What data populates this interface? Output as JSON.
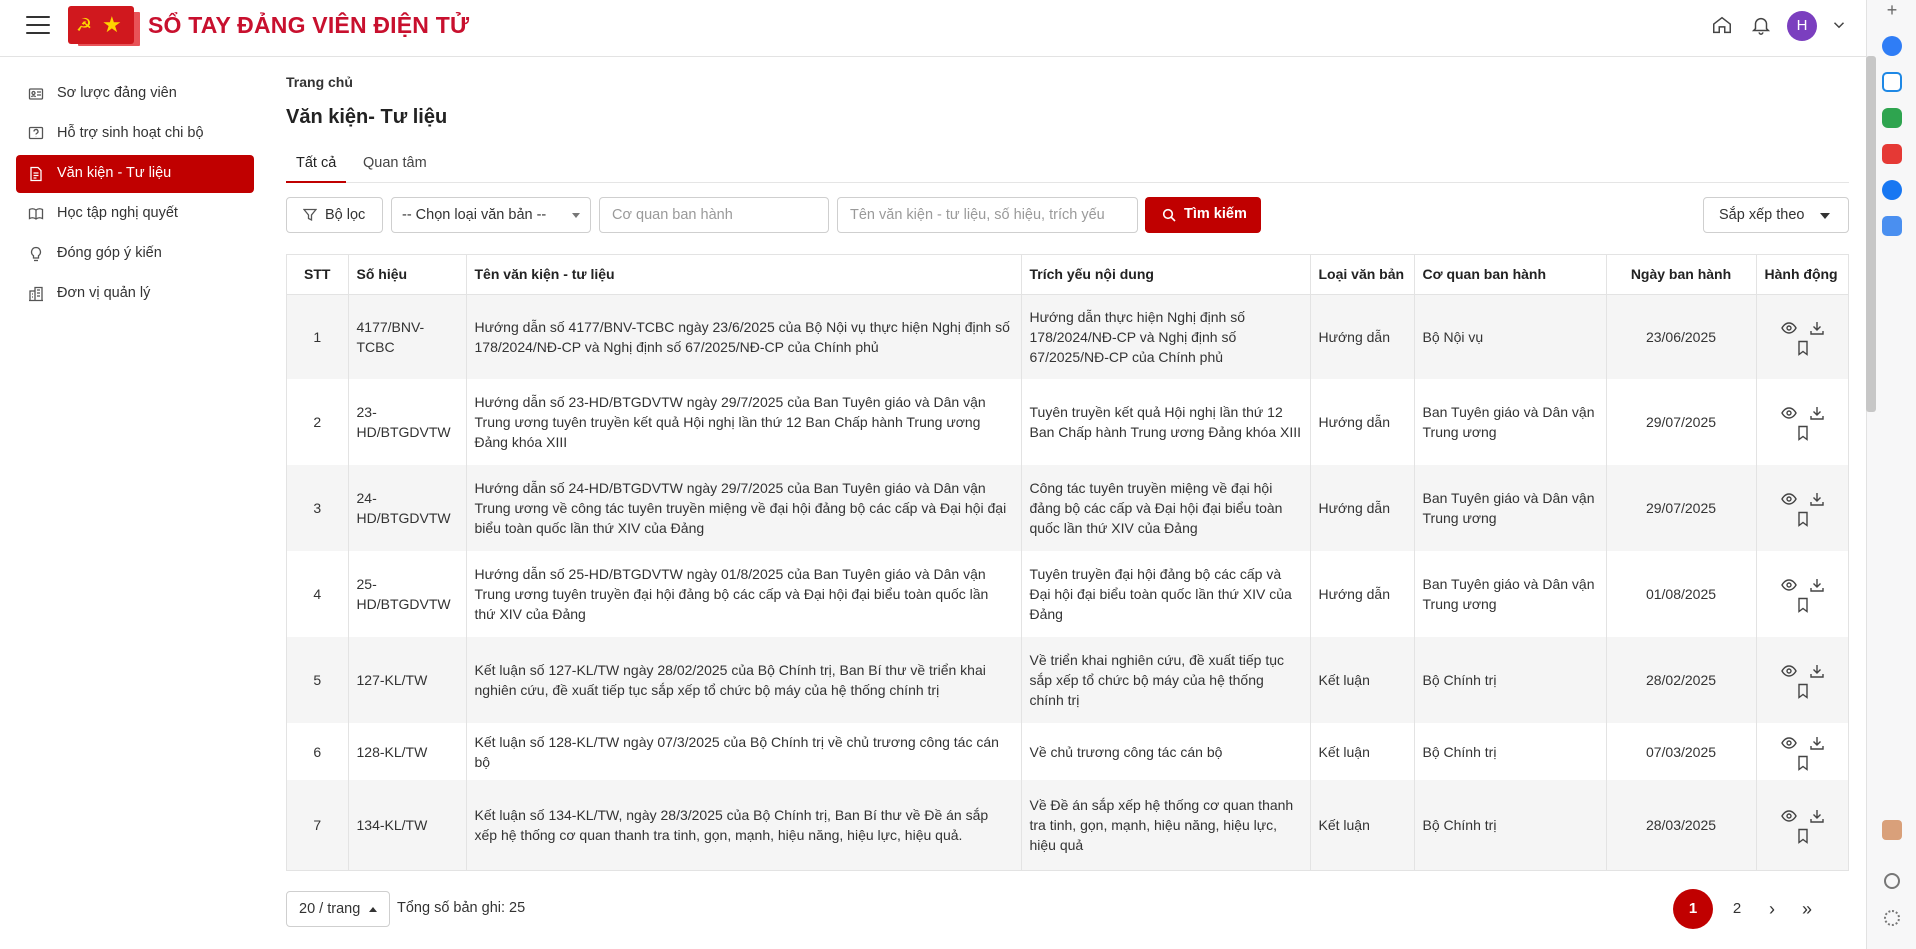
{
  "header": {
    "app_title": "SỔ TAY ĐẢNG VIÊN ĐIỆN TỬ",
    "avatar_initial": "H"
  },
  "sidebar": {
    "items": [
      {
        "label": "Sơ lược đảng viên",
        "icon": "id-card-icon"
      },
      {
        "label": "Hỗ trợ sinh hoạt chi bộ",
        "icon": "help-icon"
      },
      {
        "label": "Văn kiện - Tư liệu",
        "icon": "document-icon"
      },
      {
        "label": "Học tập nghị quyết",
        "icon": "book-icon"
      },
      {
        "label": "Đóng góp ý kiến",
        "icon": "lightbulb-icon"
      },
      {
        "label": "Đơn vị quản lý",
        "icon": "building-icon"
      }
    ]
  },
  "main": {
    "breadcrumb": "Trang chủ",
    "title": "Văn kiện- Tư liệu",
    "tabs": [
      {
        "label": "Tất cả"
      },
      {
        "label": "Quan tâm"
      }
    ],
    "filter_label": "Bộ lọc",
    "doc_type_select": "-- Chọn loại văn bản --",
    "agency_placeholder": "Cơ quan ban hành",
    "name_placeholder": "Tên văn kiện - tư liệu, số hiệu, trích yếu",
    "search_label": "Tìm kiếm",
    "sort_label": "Sắp xếp theo"
  },
  "table": {
    "headers": [
      "STT",
      "Số hiệu",
      "Tên văn kiện - tư liệu",
      "Trích yếu nội dung",
      "Loại văn bản",
      "Cơ quan ban hành",
      "Ngày ban hành",
      "Hành động"
    ],
    "rows": [
      {
        "stt": "1",
        "so_hieu": "4177/BNV-TCBC",
        "ten": "Hướng dẫn số 4177/BNV-TCBC ngày 23/6/2025 của Bộ Nội vụ thực hiện Nghị định số 178/2024/NĐ-CP và Nghị định số 67/2025/NĐ-CP của Chính phủ",
        "trich_yeu": "Hướng dẫn thực hiện Nghị định số 178/2024/NĐ-CP và Nghị định số 67/2025/NĐ-CP của Chính phủ",
        "loai": "Hướng dẫn",
        "co_quan": "Bộ Nội vụ",
        "ngay": "23/06/2025"
      },
      {
        "stt": "2",
        "so_hieu": "23-HD/BTGDVTW",
        "ten": "Hướng dẫn số 23-HD/BTGDVTW ngày 29/7/2025 của Ban Tuyên giáo và Dân vận Trung ương tuyên truyền kết quả Hội nghị lần thứ 12 Ban Chấp hành Trung ương Đảng khóa XIII",
        "trich_yeu": "Tuyên truyền kết quả Hội nghị lần thứ 12 Ban Chấp hành Trung ương Đảng khóa XIII",
        "loai": "Hướng dẫn",
        "co_quan": "Ban Tuyên giáo và Dân vận Trung ương",
        "ngay": "29/07/2025"
      },
      {
        "stt": "3",
        "so_hieu": "24-HD/BTGDVTW",
        "ten": "Hướng dẫn số 24-HD/BTGDVTW ngày 29/7/2025 của Ban Tuyên giáo và Dân vận Trung ương về công tác tuyên truyền miệng về đại hội đảng bộ các cấp và Đại hội đại biểu toàn quốc lần thứ XIV của Đảng",
        "trich_yeu": "Công tác tuyên truyền miệng về đại hội đảng bộ các cấp và Đại hội đại biểu toàn quốc lần thứ XIV của Đảng",
        "loai": "Hướng dẫn",
        "co_quan": "Ban Tuyên giáo và Dân vận Trung ương",
        "ngay": "29/07/2025"
      },
      {
        "stt": "4",
        "so_hieu": "25-HD/BTGDVTW",
        "ten": "Hướng dẫn số 25-HD/BTGDVTW ngày 01/8/2025 của Ban Tuyên giáo và Dân vận Trung ương tuyên truyền đại hội đảng bộ các cấp và Đại hội đại biểu toàn quốc lần thứ XIV của Đảng",
        "trich_yeu": "Tuyên truyền đại hội đảng bộ các cấp và Đại hội đại biểu toàn quốc lần thứ XIV của Đảng",
        "loai": "Hướng dẫn",
        "co_quan": "Ban Tuyên giáo và Dân vận Trung ương",
        "ngay": "01/08/2025"
      },
      {
        "stt": "5",
        "so_hieu": "127-KL/TW",
        "ten": "Kết luận số 127-KL/TW ngày 28/02/2025 của Bộ Chính trị, Ban Bí thư về triển khai nghiên cứu, đề xuất tiếp tục sắp xếp tổ chức bộ máy của hệ thống chính trị",
        "trich_yeu": "Về triển khai nghiên cứu, đề xuất tiếp tục sắp xếp tổ chức bộ máy của hệ thống chính trị",
        "loai": "Kết luận",
        "co_quan": "Bộ Chính trị",
        "ngay": "28/02/2025"
      },
      {
        "stt": "6",
        "so_hieu": "128-KL/TW",
        "ten": "Kết luận số 128-KL/TW ngày 07/3/2025 của Bộ Chính trị về chủ trương công tác cán bộ",
        "trich_yeu": "Về chủ trương công tác cán bộ",
        "loai": "Kết luận",
        "co_quan": "Bộ Chính trị",
        "ngay": "07/03/2025"
      },
      {
        "stt": "7",
        "so_hieu": "134-KL/TW",
        "ten": "Kết luận số 134-KL/TW, ngày 28/3/2025 của Bộ Chính trị, Ban Bí thư về Đề án sắp xếp hệ thống cơ quan thanh tra tinh, gọn, mạnh, hiệu năng, hiệu lực, hiệu quả.",
        "trich_yeu": "Về Đề án sắp xếp hệ thống cơ quan thanh tra tinh, gọn, mạnh, hiệu năng, hiệu lực, hiệu quả",
        "loai": "Kết luận",
        "co_quan": "Bộ Chính trị",
        "ngay": "28/03/2025"
      }
    ]
  },
  "footer": {
    "page_size": "20 / trang",
    "total": "Tổng số bản ghi: 25",
    "pages": [
      "1",
      "2"
    ],
    "next": "›",
    "last": "»"
  },
  "colors": {
    "primary": "#c00000",
    "title_red": "#c8102e",
    "avatar": "#7b3fbf"
  }
}
